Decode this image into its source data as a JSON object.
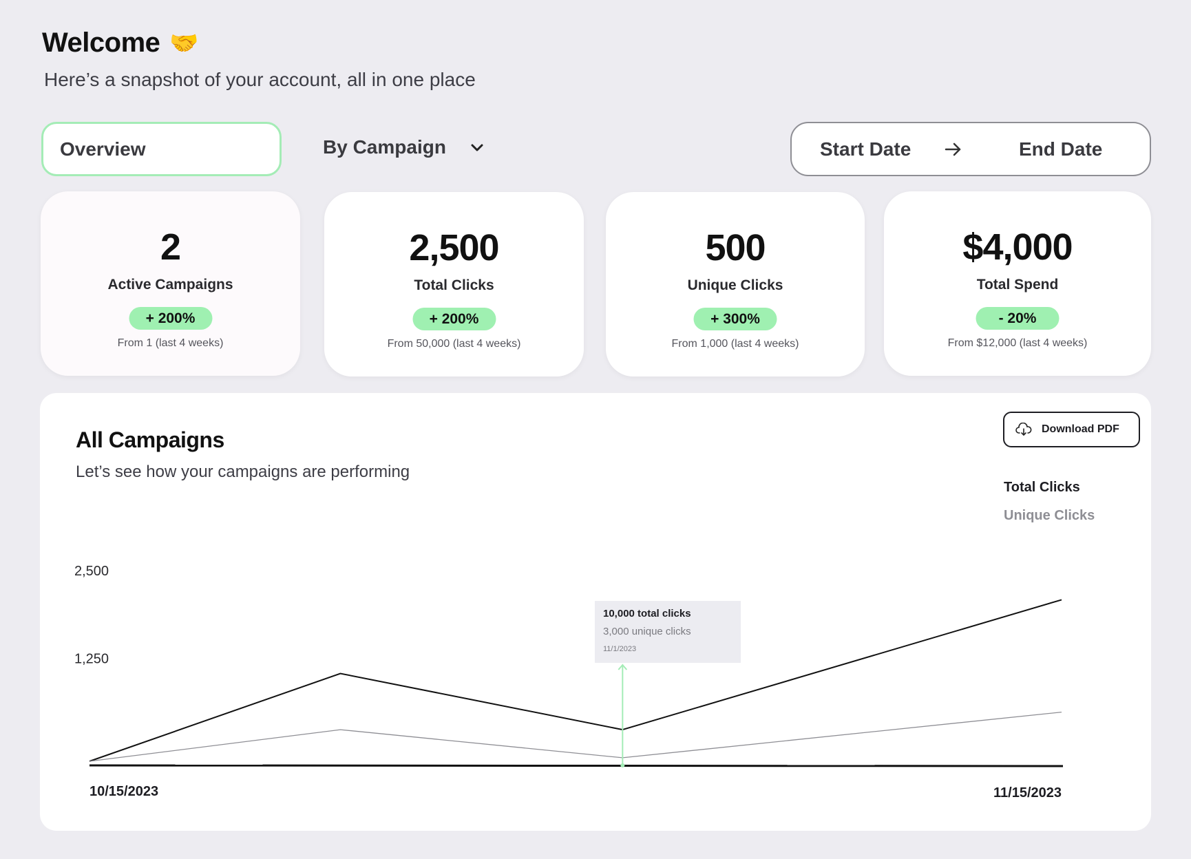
{
  "header": {
    "title": "Welcome",
    "title_icon": "handshake-icon",
    "subtitle": "Here’s a snapshot of your account, all in one place"
  },
  "tabs": {
    "overview_label": "Overview",
    "campaign_select_label": "By Campaign"
  },
  "date_range": {
    "start_label": "Start Date",
    "end_label": "End Date"
  },
  "stats": [
    {
      "value": "2",
      "label": "Active Campaigns",
      "change": "+ 200%",
      "from": "From 1 (last 4 weeks)"
    },
    {
      "value": "2,500",
      "label": "Total Clicks",
      "change": "+ 200%",
      "from": "From 50,000 (last 4 weeks)"
    },
    {
      "value": "500",
      "label": "Unique Clicks",
      "change": "+ 300%",
      "from": "From 1,000 (last 4 weeks)"
    },
    {
      "value": "$4,000",
      "label": "Total Spend",
      "change": "- 20%",
      "from": "From $12,000 (last 4 weeks)"
    }
  ],
  "colors": {
    "accent_green": "#9ff0b1",
    "tab_border": "#a4ecb6",
    "marker_green": "#a4ecb6",
    "background": "#edecf1"
  },
  "panel": {
    "title": "All Campaigns",
    "subtitle": "Let’s see how your campaigns are performing",
    "download_label": "Download PDF",
    "legend": {
      "total": "Total Clicks",
      "unique": "Unique Clicks"
    },
    "tooltip": {
      "total": "10,000 total clicks",
      "unique": "3,000 unique clicks",
      "date": "11/1/2023"
    }
  },
  "chart_data": {
    "type": "line",
    "x": [
      "10/15/2023",
      "10/23/2023",
      "11/1/2023",
      "11/15/2023"
    ],
    "x_tick_labels": [
      "10/15/2023",
      "11/15/2023"
    ],
    "y_tick_labels": [
      "2,500",
      "1,250"
    ],
    "ylim": [
      0,
      2500
    ],
    "series": [
      {
        "name": "Total Clicks",
        "color": "#111111",
        "values": [
          0,
          1250,
          450,
          2300
        ]
      },
      {
        "name": "Unique Clicks",
        "color": "#8e8e94",
        "values": [
          0,
          450,
          50,
          700
        ]
      }
    ],
    "marker_x": "11/1/2023",
    "grid": false
  }
}
